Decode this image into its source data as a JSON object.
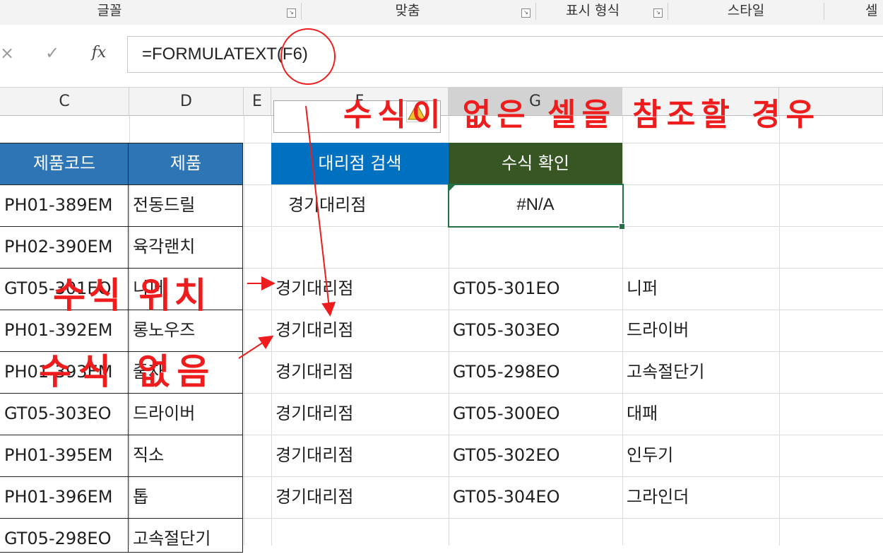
{
  "ribbon": {
    "groups": [
      "글꼴",
      "맞춤",
      "표시 형식",
      "스타일",
      "셀"
    ]
  },
  "formula_bar": {
    "cancel_icon": "×",
    "enter_icon": "✓",
    "fx_label": "fx",
    "formula": "=FORMULATEXT(F6)"
  },
  "columns": [
    "C",
    "D",
    "E",
    "F",
    "G"
  ],
  "selected_column": "G",
  "left_table": {
    "headers": [
      "제품코드",
      "제품"
    ],
    "rows": [
      [
        "PH01-389EM",
        "전동드릴"
      ],
      [
        "PH02-390EM",
        "육각랜치"
      ],
      [
        "GT05-301EO",
        "니퍼"
      ],
      [
        "PH01-392EM",
        "롱노우즈"
      ],
      [
        "PH01-393EM",
        "줄자"
      ],
      [
        "GT05-303EO",
        "드라이버"
      ],
      [
        "PH01-395EM",
        "직소"
      ],
      [
        "PH01-396EM",
        "톱"
      ],
      [
        "GT05-298EO",
        "고속절단기"
      ]
    ]
  },
  "lookup": {
    "header_search": "대리점 검색",
    "header_check": "수식 확인",
    "search_value": "경기대리점",
    "check_value": "#N/A"
  },
  "right_table": {
    "rows": [
      [
        "경기대리점",
        "GT05-301EO",
        "니퍼"
      ],
      [
        "경기대리점",
        "GT05-303EO",
        "드라이버"
      ],
      [
        "경기대리점",
        "GT05-298EO",
        "고속절단기"
      ],
      [
        "경기대리점",
        "GT05-300EO",
        "대패"
      ],
      [
        "경기대리점",
        "GT05-302EO",
        "인두기"
      ],
      [
        "경기대리점",
        "GT05-304EO",
        "그라인더"
      ]
    ]
  },
  "annotations": {
    "title": "수식이 없은 셀을 참조할 경우",
    "formula_position": "수식 위치",
    "no_formula": "수식 없음"
  },
  "colors": {
    "annotation_red": "#ee1c1c",
    "header_blue": "#2e75b6",
    "header_blue2": "#0070c0",
    "header_green": "#375623",
    "selection_green": "#217346"
  },
  "icons": {
    "warning": "warning-triangle-icon"
  }
}
